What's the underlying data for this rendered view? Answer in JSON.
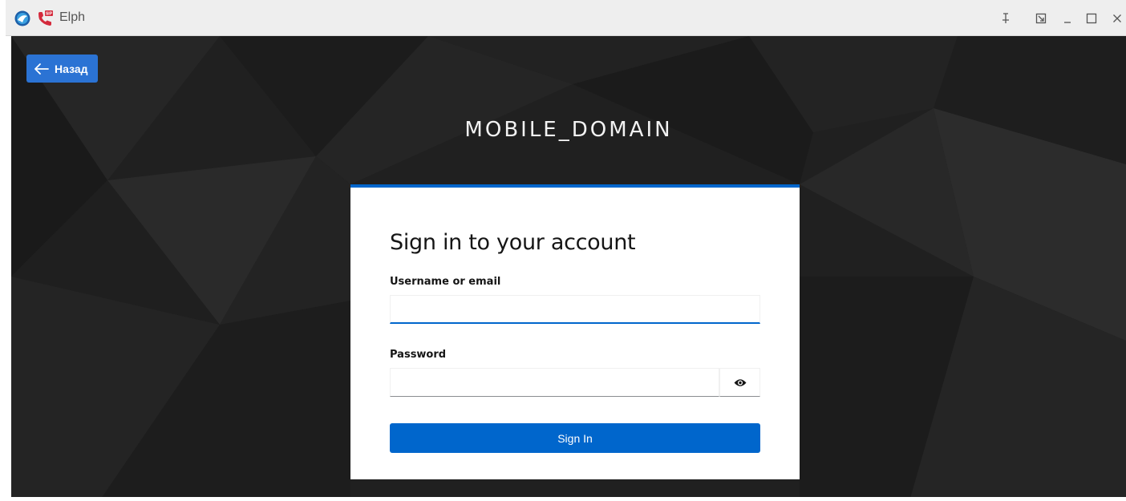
{
  "window": {
    "title": "Elph",
    "app_icon": "globe-app-icon",
    "sip_icon": "sip-phone-icon",
    "controls": {
      "pin_icon": "pin-icon",
      "restore_icon": "restore-icon",
      "minimize_icon": "minimize-icon",
      "maximize_icon": "maximize-icon",
      "close_icon": "close-icon"
    }
  },
  "page": {
    "back_button": {
      "label": "Назад",
      "icon": "arrow-left-icon"
    },
    "realm_title": "MOBILE_DOMAIN",
    "login_card": {
      "heading": "Sign in to your account",
      "username_label": "Username or email",
      "username_value": "",
      "password_label": "Password",
      "password_value": "",
      "password_toggle_icon": "eye-icon",
      "submit_label": "Sign In"
    }
  },
  "colors": {
    "accent": "#0066cc",
    "back_button": "#2b73d4",
    "background": "#1e1e1e"
  }
}
